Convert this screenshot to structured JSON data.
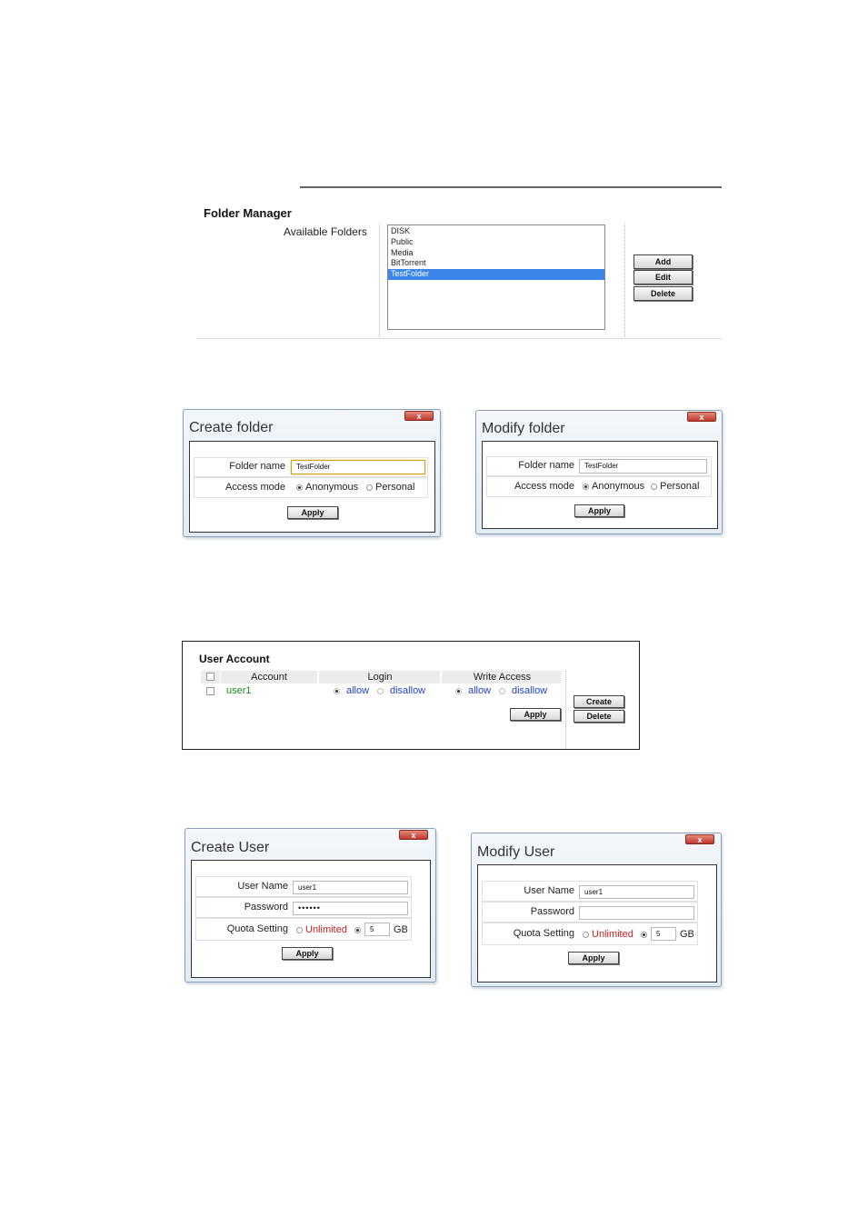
{
  "folder_manager": {
    "title": "Folder Manager",
    "available_label": "Available Folders",
    "folders": [
      "DISK",
      "Public",
      "Media",
      "BitTorrent",
      "TestFolder"
    ],
    "selected_index": 4,
    "add_label": "Add",
    "edit_label": "Edit",
    "delete_label": "Delete"
  },
  "create_folder": {
    "title": "Create folder",
    "close_label": "x",
    "folder_name_label": "Folder name",
    "folder_name_value": "TestFolder",
    "access_mode_label": "Access mode",
    "anonymous_label": "Anonymous",
    "personal_label": "Personal",
    "apply_label": "Apply"
  },
  "modify_folder": {
    "title": "Modify folder",
    "close_label": "x",
    "folder_name_label": "Folder name",
    "folder_name_value": "TestFolder",
    "access_mode_label": "Access mode",
    "anonymous_label": "Anonymous",
    "personal_label": "Personal",
    "apply_label": "Apply"
  },
  "user_account": {
    "title": "User Account",
    "columns": [
      "Account",
      "Login",
      "Write Access"
    ],
    "rows": [
      {
        "account": "user1",
        "login_allow": "allow",
        "login_disallow": "disallow",
        "write_allow": "allow",
        "write_disallow": "disallow"
      }
    ],
    "apply_label": "Apply",
    "create_label": "Create",
    "delete_label": "Delete"
  },
  "create_user": {
    "title": "Create User",
    "close_label": "x",
    "user_name_label": "User Name",
    "user_name_value": "user1",
    "password_label": "Password",
    "password_value": "••••••",
    "quota_label": "Quota Setting",
    "unlimited_label": "Unlimited",
    "quota_value": "5",
    "quota_unit": "GB",
    "apply_label": "Apply"
  },
  "modify_user": {
    "title": "Modify User",
    "close_label": "x",
    "user_name_label": "User Name",
    "user_name_value": "user1",
    "password_label": "Password",
    "password_value": "",
    "quota_label": "Quota Setting",
    "unlimited_label": "Unlimited",
    "quota_value": "5",
    "quota_unit": "GB",
    "apply_label": "Apply"
  }
}
